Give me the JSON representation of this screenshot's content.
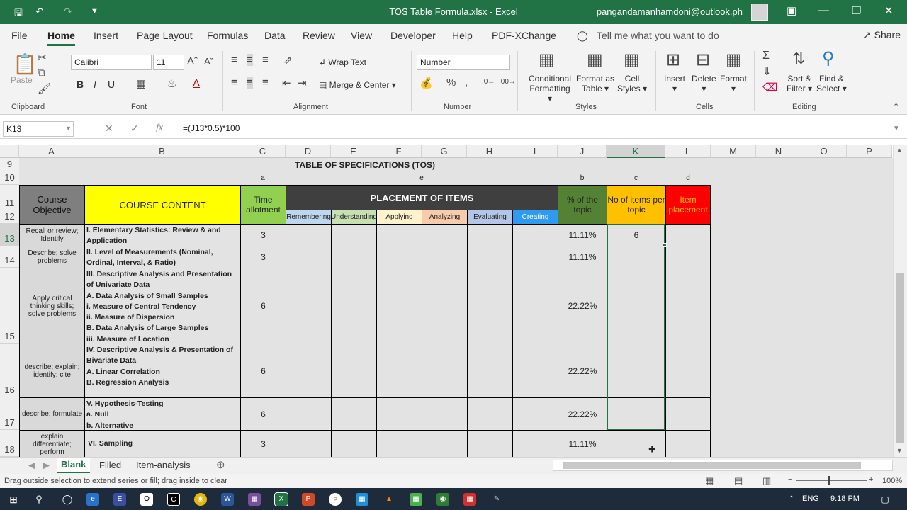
{
  "title": "TOS Table Formula.xlsx  -  Excel",
  "user": "pangandamanhamdoni@outlook.ph",
  "tabs": [
    "File",
    "Home",
    "Insert",
    "Page Layout",
    "Formulas",
    "Data",
    "Review",
    "View",
    "Developer",
    "Help",
    "PDF-XChange"
  ],
  "tell_me": "Tell me what you want to do",
  "share": "Share",
  "ribbon": {
    "paste": "Paste",
    "clipboard": "Clipboard",
    "font_name": "Calibri",
    "font_size": "11",
    "font": "Font",
    "wrap_text": "Wrap Text",
    "merge_center": "Merge & Center",
    "alignment": "Alignment",
    "number_format": "Number",
    "number": "Number",
    "cond_fmt": "Conditional",
    "cond_fmt2": "Formatting",
    "fmt_table": "Format as",
    "fmt_table2": "Table",
    "cell_styles": "Cell",
    "cell_styles2": "Styles",
    "styles": "Styles",
    "insert": "Insert",
    "delete": "Delete",
    "format": "Format",
    "cells": "Cells",
    "sort_filter": "Sort &",
    "sort_filter2": "Filter",
    "find_select": "Find &",
    "find_select2": "Select",
    "editing": "Editing",
    "bold": "B",
    "italic": "I",
    "underline": "U",
    "fx": "fx",
    "autosum": "Σ"
  },
  "namebox": "K13",
  "formula": "=(J13*0.5)*100",
  "columns": [
    "A",
    "B",
    "C",
    "D",
    "E",
    "F",
    "G",
    "H",
    "I",
    "J",
    "K",
    "L",
    "M",
    "N",
    "O",
    "P"
  ],
  "rows": [
    "9",
    "10",
    "11",
    "12",
    "13",
    "14",
    "15",
    "16",
    "17",
    "18"
  ],
  "sheet": {
    "title": "TABLE OF SPECIFICATIONS (TOS)",
    "row10": {
      "c": "a",
      "f": "e",
      "j": "b",
      "k": "c",
      "l": "d"
    },
    "hdr_objective": "Course Objective",
    "hdr_content": "COURSE CONTENT",
    "hdr_time": "Time allotment",
    "hdr_placement": "PLACEMENT OF ITEMS",
    "levels": [
      "Remembering",
      "Understanding",
      "Applying",
      "Analyzing",
      "Evaluating",
      "Creating"
    ],
    "hdr_pct": "% of the topic",
    "hdr_items": "No of items per topic",
    "hdr_itemplace": "Item placement",
    "data": [
      {
        "obj": "Recall or review; Identify",
        "content": "I. Elementary Statistics: Review & and Application",
        "time": "3",
        "pct": "11.11%",
        "items": "6"
      },
      {
        "obj": "Describe; solve problems",
        "content": "II. Level of  Measurements (Nominal, Ordinal, Interval, & Ratio)",
        "time": "3",
        "pct": "11.11%",
        "items": ""
      },
      {
        "obj": "Apply critical thinking skills; solve problems",
        "content": "III. Descriptive Analysis and Presentation of Univariate Data\nA. Data Analysis of  Small Samples\ni. Measure of Central Tendency\nii. Measure of Dispersion\nB. Data Analysis of Large Samples\niii. Measure of Location",
        "time": "6",
        "pct": "22.22%",
        "items": ""
      },
      {
        "obj": "describe; explain; identify; cite",
        "content": "IV. Descriptive Analysis & Presentation of Bivariate Data\nA. Linear Correlation\nB. Regression Analysis",
        "time": "6",
        "pct": "22.22%",
        "items": ""
      },
      {
        "obj": "describe; formulate",
        "content": "V. Hypothesis-Testing\na. Null\nb. Alternative",
        "time": "6",
        "pct": "22.22%",
        "items": ""
      },
      {
        "obj": "explain differentiate; perform",
        "content": "VI. Sampling",
        "time": "3",
        "pct": "11.11%",
        "items": ""
      }
    ]
  },
  "sheet_tabs": [
    "Blank",
    "Filled",
    "Item-analysis"
  ],
  "status": "Drag outside selection to extend series or fill; drag inside to clear",
  "zoom": "100%",
  "taskbar": {
    "lang": "ENG",
    "time": "9:18 PM"
  }
}
